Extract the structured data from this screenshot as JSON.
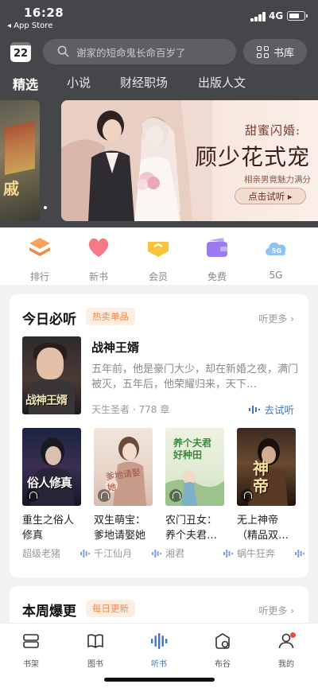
{
  "status_bar": {
    "time": "16:28",
    "back_app": "◂ App Store",
    "network": "4G",
    "battery_level": 0.75
  },
  "header": {
    "calendar_day": "22",
    "search_placeholder": "谢家的短命鬼长命百岁了",
    "library_label": "书库",
    "tabs": [
      {
        "label": "精选",
        "active": true
      },
      {
        "label": "小说",
        "active": false
      },
      {
        "label": "财经职场",
        "active": false
      },
      {
        "label": "出版人文",
        "active": false
      }
    ]
  },
  "banner": {
    "left_peek_text": "戚",
    "subtitle": "甜蜜闪婚:",
    "title": "顾少花式宠",
    "description": "相亲男竟魅力满分",
    "button_label": "点击试听 ▸"
  },
  "categories": [
    {
      "label": "排行",
      "icon": "ranking-icon"
    },
    {
      "label": "新书",
      "icon": "heart-icon"
    },
    {
      "label": "会员",
      "icon": "vip-icon"
    },
    {
      "label": "免费",
      "icon": "wallet-icon"
    },
    {
      "label": "5G",
      "icon": "5g-cloud-icon"
    }
  ],
  "today": {
    "title": "今日必听",
    "badge": "热卖单品",
    "more": "听更多 ›",
    "featured": {
      "cover_text": "战神王婿",
      "title": "战神王婿",
      "description": "五年前，他是豪门大少，却在新婚之夜，满门被灭，五年后，他荣耀归来，天下…",
      "author": "天生圣者",
      "chapters": "778 章",
      "try_label": "去试听"
    },
    "books": [
      {
        "cover_text": "俗人修真",
        "title": "重生之俗人修真",
        "author": "超级老猪"
      },
      {
        "cover_text": "爹地请娶她",
        "title": "双生萌宝：爹地请娶她",
        "author": "千江仙月"
      },
      {
        "cover_text": "养个夫君好种田",
        "title": "农门丑女：养个夫君…",
        "author": "湘君"
      },
      {
        "cover_text": "神帝",
        "title": "无上神帝（精品双…",
        "author": "蜗牛狂奔"
      }
    ]
  },
  "weekly": {
    "title": "本周爆更",
    "badge": "每日更新",
    "more": "听更多 ›"
  },
  "tabbar": [
    {
      "label": "书架",
      "icon": "bookshelf-icon",
      "active": false
    },
    {
      "label": "图书",
      "icon": "book-icon",
      "active": false
    },
    {
      "label": "听书",
      "icon": "audio-wave-icon",
      "active": true
    },
    {
      "label": "布谷",
      "icon": "cuckoo-icon",
      "active": false
    },
    {
      "label": "我的",
      "icon": "profile-icon",
      "active": false
    }
  ],
  "colors": {
    "header_bg": "#444649",
    "accent_blue": "#3d73c9",
    "badge_orange": "#ef8a4a",
    "notification_red": "#f04a3e"
  }
}
